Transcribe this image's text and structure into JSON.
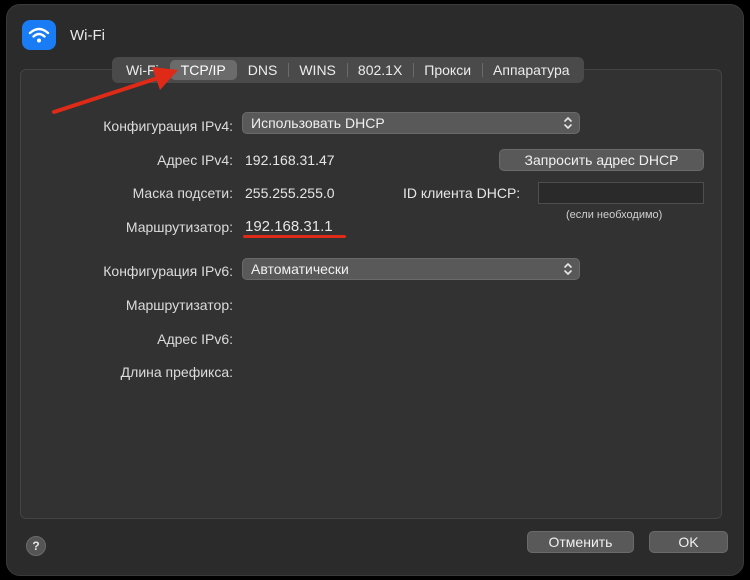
{
  "window": {
    "title": "Wi-Fi"
  },
  "tabs": [
    {
      "label": "Wi-Fi"
    },
    {
      "label": "TCP/IP",
      "active": true
    },
    {
      "label": "DNS"
    },
    {
      "label": "WINS"
    },
    {
      "label": "802.1X"
    },
    {
      "label": "Прокси"
    },
    {
      "label": "Аппаратура"
    }
  ],
  "ipv4": {
    "config_label": "Конфигурация IPv4:",
    "config_value": "Использовать DHCP",
    "address_label": "Адрес IPv4:",
    "address_value": "192.168.31.47",
    "mask_label": "Маска подсети:",
    "mask_value": "255.255.255.0",
    "router_label": "Маршрутизатор:",
    "router_value": "192.168.31.1",
    "renew_button": "Запросить адрес DHCP",
    "client_id_label": "ID клиента DHCP:",
    "client_id_value": "",
    "client_id_hint": "(если необходимо)"
  },
  "ipv6": {
    "config_label": "Конфигурация IPv6:",
    "config_value": "Автоматически",
    "router_label": "Маршрутизатор:",
    "address_label": "Адрес IPv6:",
    "prefix_label": "Длина префикса:"
  },
  "footer": {
    "help": "?",
    "cancel": "Отменить",
    "ok": "OK"
  },
  "colors": {
    "accent": "#1a7cf5",
    "annotation": "#e02a18"
  },
  "icons": [
    "wifi-icon",
    "updown-arrows-icon",
    "help-icon",
    "annotation-arrow-icon"
  ]
}
